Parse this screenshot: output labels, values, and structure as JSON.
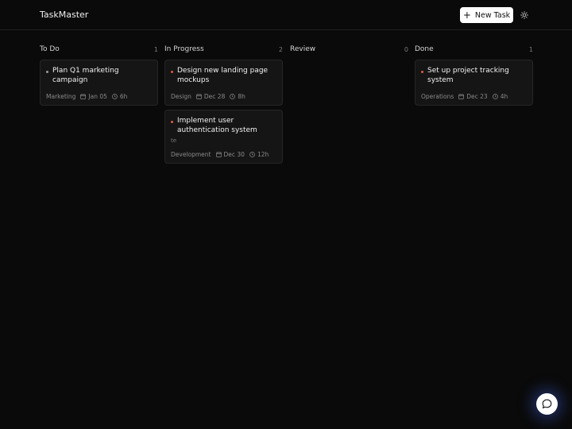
{
  "app": {
    "title": "TaskMaster"
  },
  "header": {
    "new_task_label": "New Task"
  },
  "colors": {
    "priority_low": "#9a9a9a",
    "priority_high": "#e05a4a",
    "accent_glow": "#466eff"
  },
  "columns": [
    {
      "name": "To Do",
      "count": "1",
      "cards": [
        {
          "title": "Plan Q1 marketing campaign",
          "description": "",
          "priority": "low",
          "tag": "Marketing",
          "date": "Jan 05",
          "hours": "6h"
        }
      ]
    },
    {
      "name": "In Progress",
      "count": "2",
      "cards": [
        {
          "title": "Design new landing page mockups",
          "description": "",
          "priority": "high",
          "tag": "Design",
          "date": "Dec 28",
          "hours": "8h"
        },
        {
          "title": "Implement user authentication system",
          "description": "te",
          "priority": "high",
          "tag": "Development",
          "date": "Dec 30",
          "hours": "12h"
        }
      ]
    },
    {
      "name": "Review",
      "count": "0",
      "cards": []
    },
    {
      "name": "Done",
      "count": "1",
      "cards": [
        {
          "title": "Set up project tracking system",
          "description": "",
          "priority": "high",
          "tag": "Operations",
          "date": "Dec 23",
          "hours": "4h"
        }
      ]
    }
  ]
}
